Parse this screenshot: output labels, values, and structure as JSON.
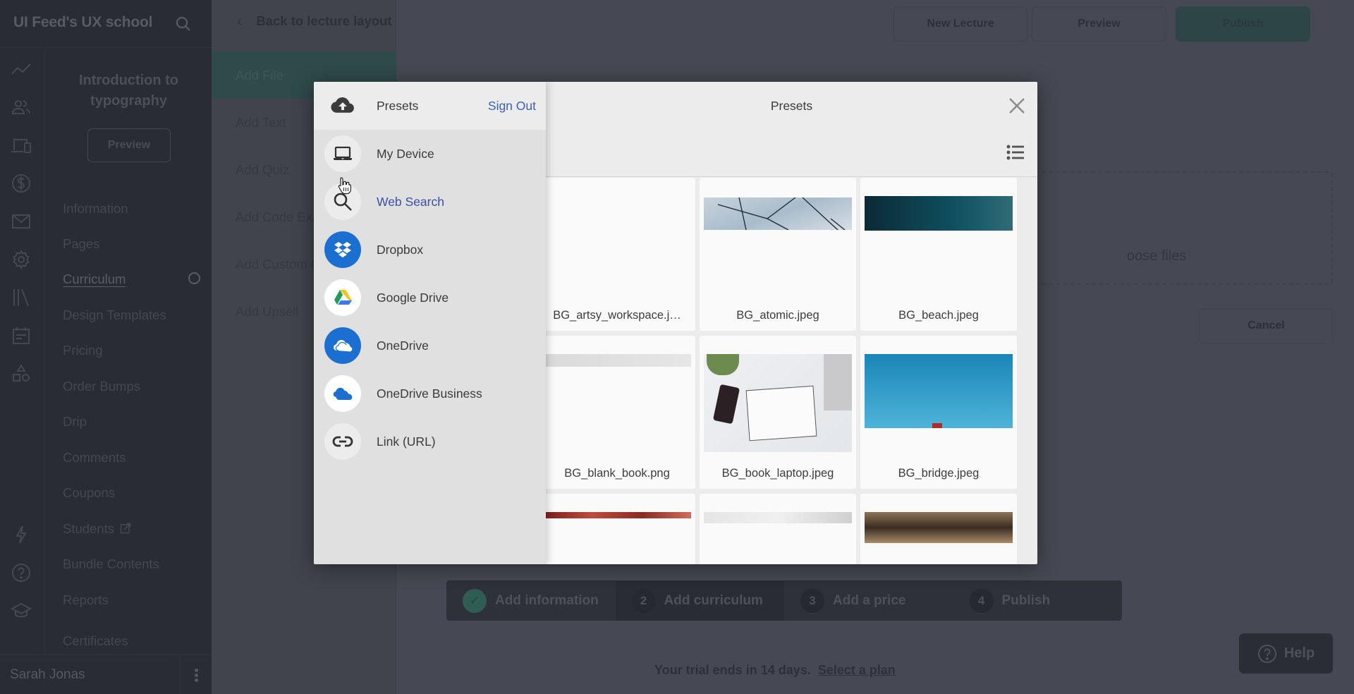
{
  "app": {
    "brand": "UI Feed's UX school",
    "course_title": "Introduction to typography",
    "course_preview_label": "Preview"
  },
  "rail_icons": [
    "analytics-icon",
    "users-icon",
    "devices-icon",
    "dollar-icon",
    "mail-icon",
    "settings-icon",
    "library-icon",
    "calendar-icon",
    "shapes-icon",
    "lightning-icon",
    "help-circle-icon",
    "graduation-cap-icon"
  ],
  "nav": {
    "items": [
      {
        "label": "Information"
      },
      {
        "label": "Pages"
      },
      {
        "label": "Curriculum",
        "active": true
      },
      {
        "label": "Design Templates"
      },
      {
        "label": "Pricing"
      },
      {
        "label": "Order Bumps"
      },
      {
        "label": "Drip"
      },
      {
        "label": "Comments"
      },
      {
        "label": "Coupons"
      },
      {
        "label": "Students",
        "external": true
      },
      {
        "label": "Bundle Contents"
      },
      {
        "label": "Reports"
      },
      {
        "label": "Certificates"
      }
    ]
  },
  "user": {
    "name": "Sarah Jonas"
  },
  "tools": {
    "back_label": "Back to lecture layout",
    "items": [
      {
        "label": "Add File",
        "active": true
      },
      {
        "label": "Add Text"
      },
      {
        "label": "Add Quiz"
      },
      {
        "label": "Add Code Example"
      },
      {
        "label": "Add Custom Code"
      },
      {
        "label": "Add Upsell"
      }
    ]
  },
  "header": {
    "new_lecture": "New Lecture",
    "preview": "Preview",
    "publish": "Publish"
  },
  "upload": {
    "dropzone_text": "Drag and drop or choose files",
    "cancel": "Cancel"
  },
  "steps": [
    {
      "num": "✓",
      "label": "Add information",
      "done": true
    },
    {
      "num": "2",
      "label": "Add curriculum",
      "current": true
    },
    {
      "num": "3",
      "label": "Add a price"
    },
    {
      "num": "4",
      "label": "Publish"
    }
  ],
  "trial": {
    "text": "Your trial ends in 14 days.",
    "link": "Select a plan"
  },
  "help_label": "Help",
  "picker": {
    "side_title": "Presets",
    "sign_out": "Sign Out",
    "main_title": "Presets",
    "sources": [
      {
        "label": "My Device",
        "icon": "laptop-icon"
      },
      {
        "label": "Web Search",
        "icon": "search-icon",
        "active": true
      },
      {
        "label": "Dropbox",
        "icon": "dropbox-icon"
      },
      {
        "label": "Google Drive",
        "icon": "google-drive-icon"
      },
      {
        "label": "OneDrive",
        "icon": "onedrive-icon"
      },
      {
        "label": "OneDrive Business",
        "icon": "onedrive-business-icon"
      },
      {
        "label": "Link (URL)",
        "icon": "link-icon"
      }
    ],
    "files": [
      {
        "name": "BG_artsy_workspace.j…"
      },
      {
        "name": "BG_atomic.jpeg"
      },
      {
        "name": "BG_beach.jpeg"
      },
      {
        "name": "BG_blank_book.png"
      },
      {
        "name": "BG_book_laptop.jpeg"
      },
      {
        "name": "BG_bridge.jpeg"
      },
      {
        "name": ""
      },
      {
        "name": ""
      },
      {
        "name": ""
      }
    ]
  },
  "colors": {
    "accent_link": "#3b5ec4",
    "onedrive_blue": "#1a6fd1",
    "publish_green": "#2d4547"
  }
}
